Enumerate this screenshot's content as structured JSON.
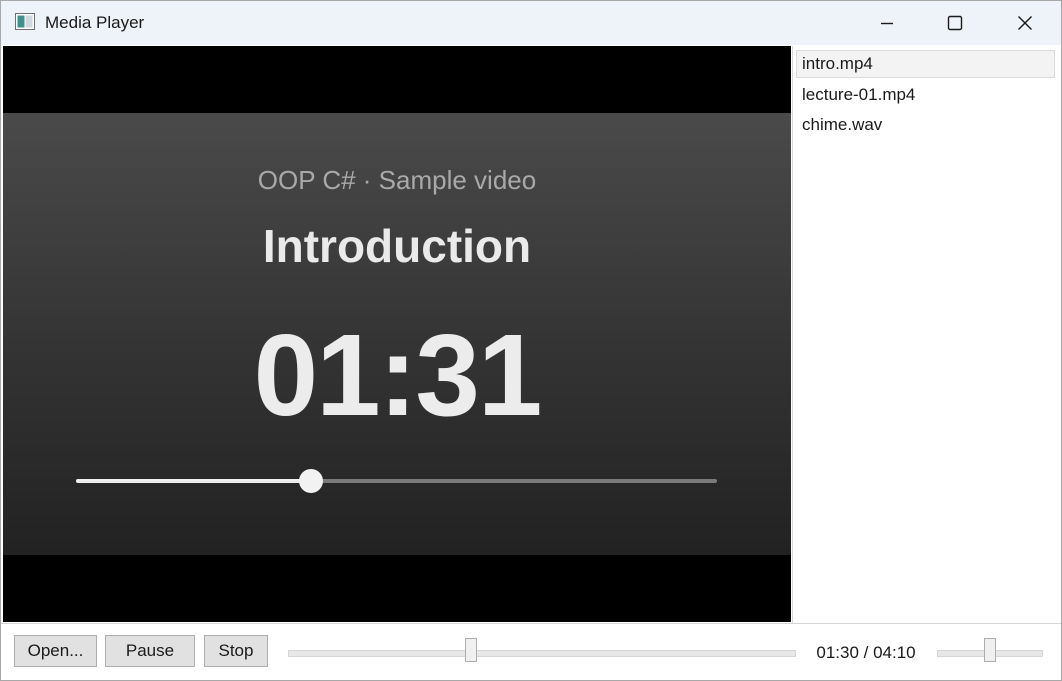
{
  "window": {
    "title": "Media Player",
    "controls": [
      "minimize-icon",
      "maximize-icon",
      "close-icon"
    ]
  },
  "video": {
    "subtitle": "OOP C# · Sample video",
    "heading": "Introduction",
    "clock": "01:31",
    "progress": 0.367
  },
  "playlist": {
    "items": [
      {
        "label": "intro.mp4",
        "selected": true
      },
      {
        "label": "lecture-01.mp4",
        "selected": false
      },
      {
        "label": "chime.wav",
        "selected": false
      }
    ]
  },
  "controls": {
    "open_label": "Open...",
    "pause_label": "Pause",
    "stop_label": "Stop",
    "time_readout": "01:30 / 04:10",
    "seek_position": 0.36,
    "volume_level": 0.5
  }
}
